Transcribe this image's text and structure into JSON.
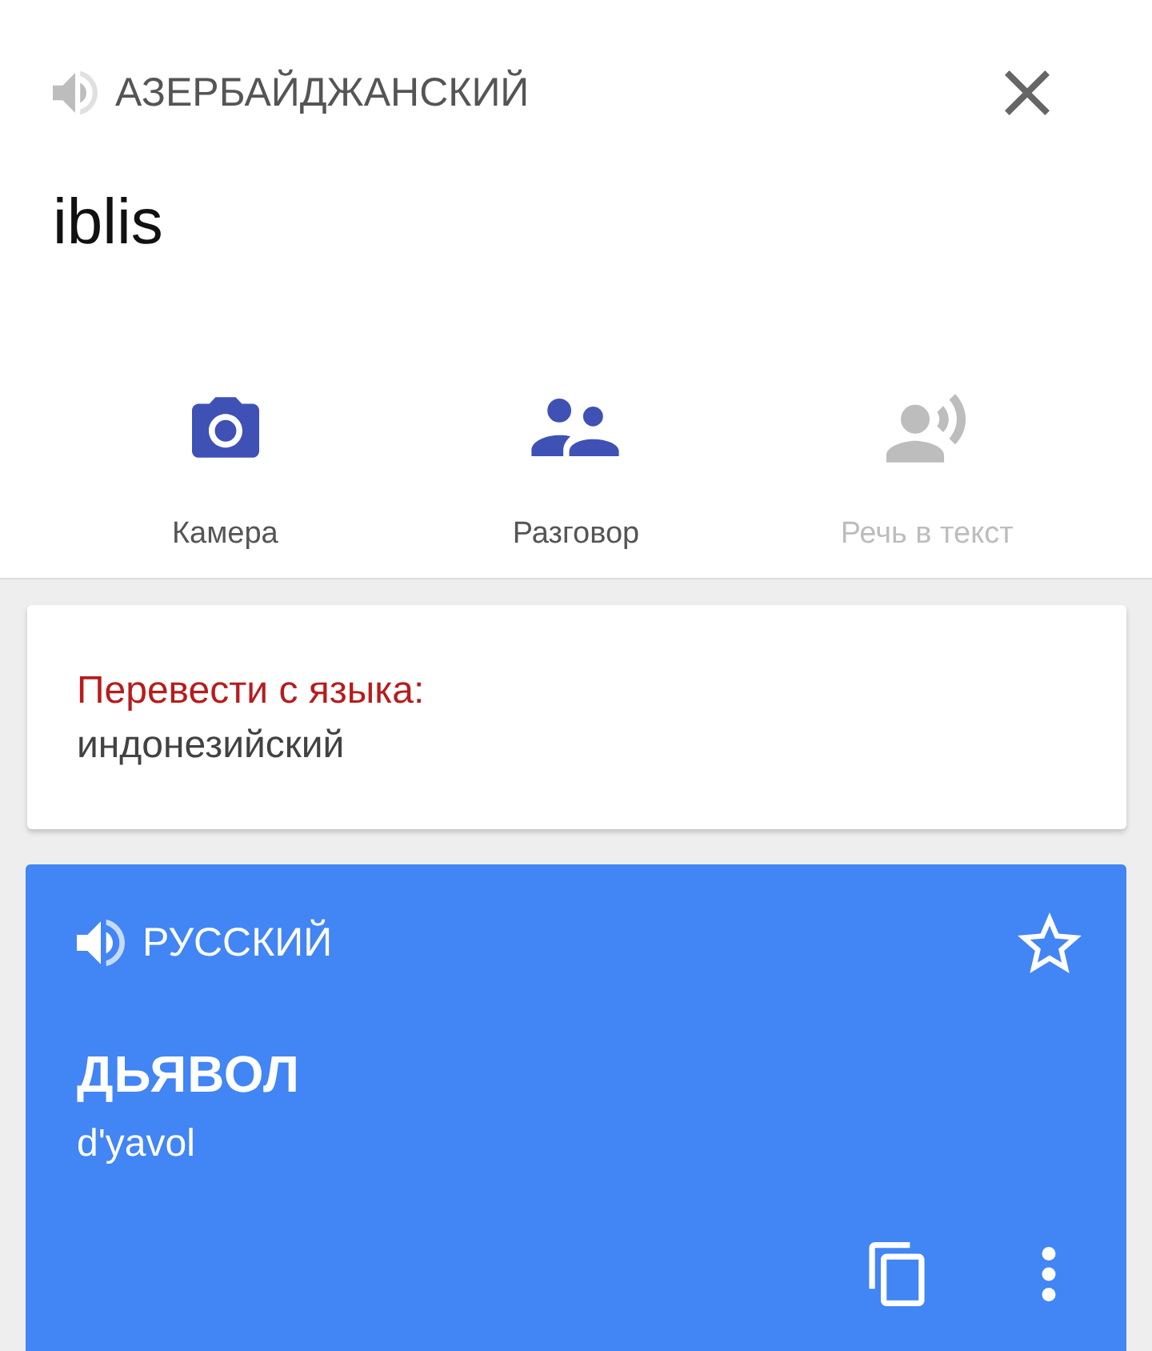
{
  "source": {
    "language": "АЗЕРБАЙДЖАНСКИЙ",
    "text": "iblis"
  },
  "actions": [
    {
      "kind": "camera",
      "label": "Камера",
      "disabled": false
    },
    {
      "kind": "conversation",
      "label": "Разговор",
      "disabled": false
    },
    {
      "kind": "speech",
      "label": "Речь в текст",
      "disabled": true
    }
  ],
  "suggestion": {
    "prompt": "Перевести с языка:",
    "language": "индонезийский"
  },
  "translation": {
    "language": "РУССКИЙ",
    "starred": false,
    "text": "ДЬЯВОЛ",
    "transliteration": "d'yavol"
  }
}
